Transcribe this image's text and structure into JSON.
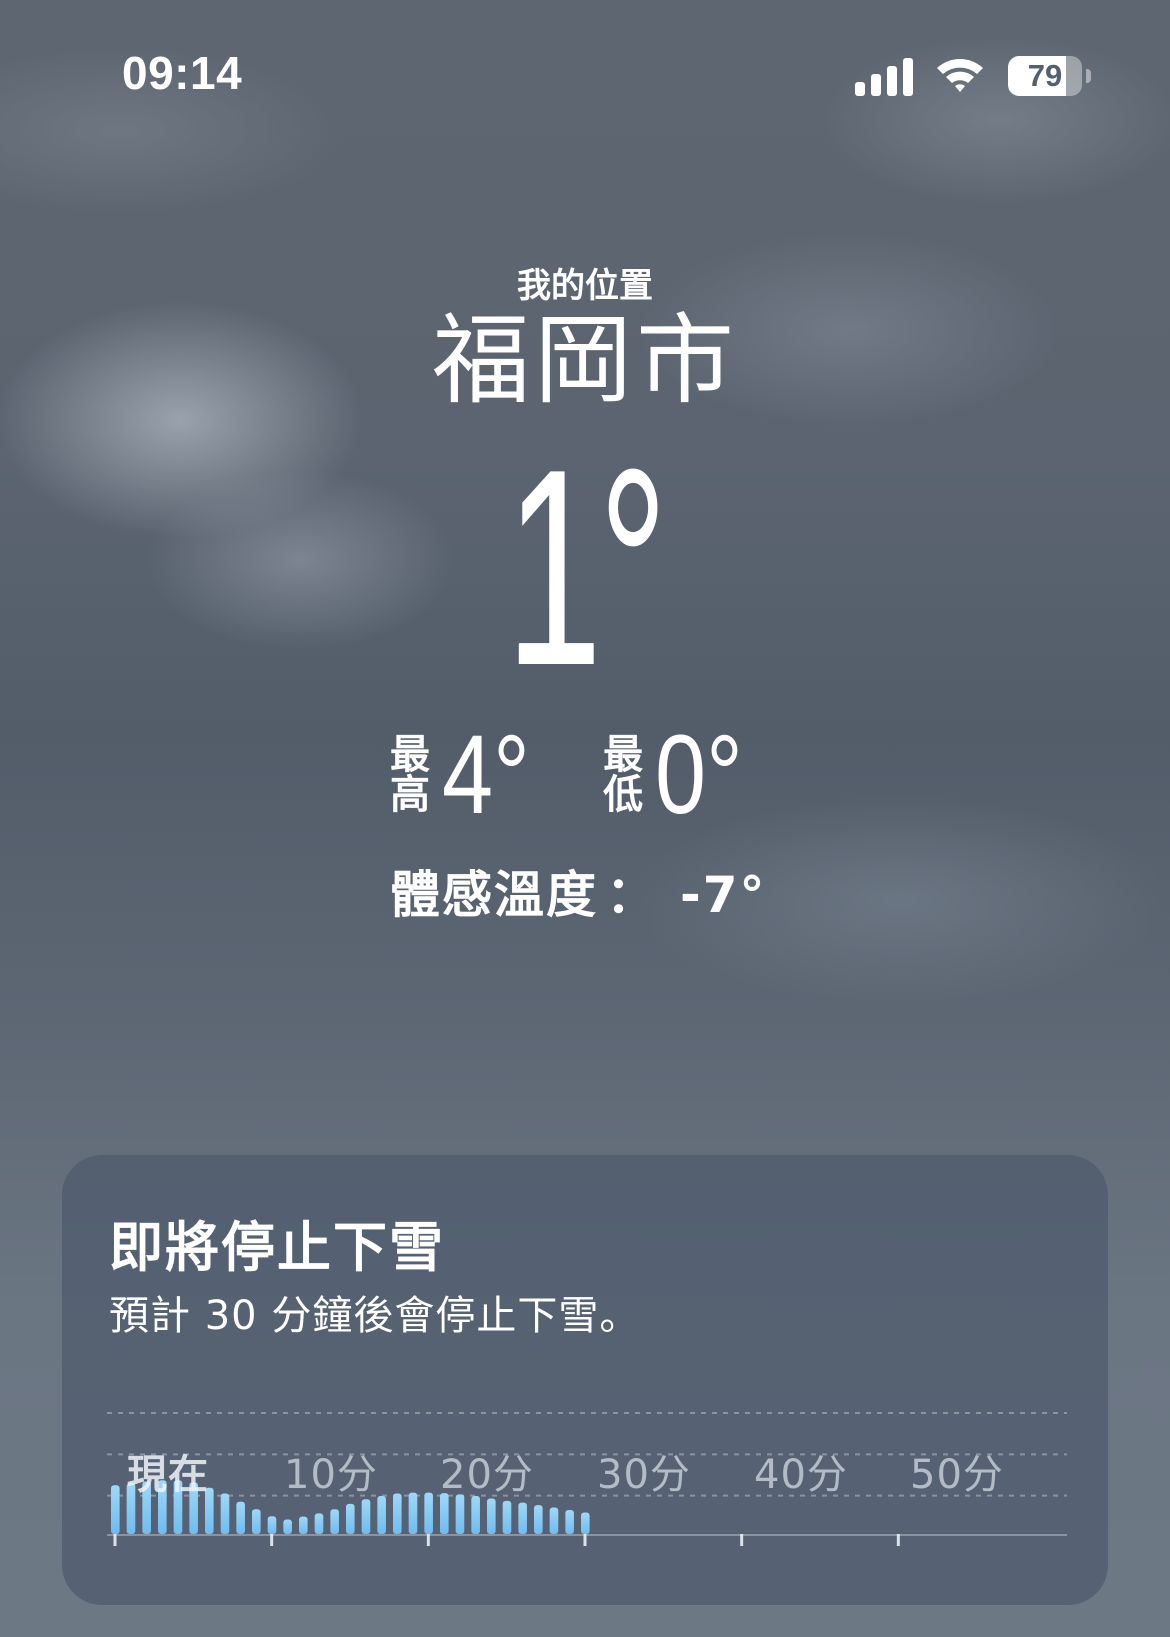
{
  "status_bar": {
    "time": "09:14",
    "battery_level": "79",
    "battery_fraction": 0.79,
    "icons": [
      "signal-icon",
      "wifi-icon",
      "battery-icon"
    ]
  },
  "location": {
    "label": "我的位置",
    "city": "福岡市"
  },
  "current": {
    "temperature": "1°",
    "high_label": "最高",
    "high_value": "4°",
    "low_label": "最低",
    "low_value": "0°",
    "feels_label": "體感溫度",
    "feels_colon": "：",
    "feels_value": "-7°"
  },
  "precip_card": {
    "title": "即將停止下雪",
    "subtitle": "預計 30 分鐘後會停止下雪。",
    "tick_labels": [
      "現在",
      "10分",
      "20分",
      "30分",
      "40分",
      "50分"
    ]
  },
  "chart_data": {
    "type": "bar",
    "x_unit": "minutes",
    "xlim": [
      0,
      60
    ],
    "ylim": [
      0,
      3
    ],
    "x_ticks": [
      0,
      10,
      20,
      30,
      40,
      50
    ],
    "gridlines": 3,
    "values": [
      1.18,
      1.23,
      1.27,
      1.3,
      1.3,
      1.25,
      1.12,
      0.98,
      0.78,
      0.6,
      0.43,
      0.35,
      0.42,
      0.5,
      0.6,
      0.73,
      0.84,
      0.92,
      0.98,
      1.0,
      1.0,
      0.99,
      0.96,
      0.92,
      0.86,
      0.8,
      0.76,
      0.7,
      0.64,
      0.58,
      0.52,
      0.0,
      0.0,
      0.0,
      0.0,
      0.0,
      0.0,
      0.0,
      0.0,
      0.0,
      0.0,
      0.0,
      0.0,
      0.0,
      0.0,
      0.0,
      0.0,
      0.0,
      0.0,
      0.0,
      0.0,
      0.0,
      0.0,
      0.0,
      0.0,
      0.0,
      0.0,
      0.0,
      0.0,
      0.0
    ],
    "bar_color": "#9fd8f7",
    "bar_color_bottom": "#6fbcef"
  }
}
